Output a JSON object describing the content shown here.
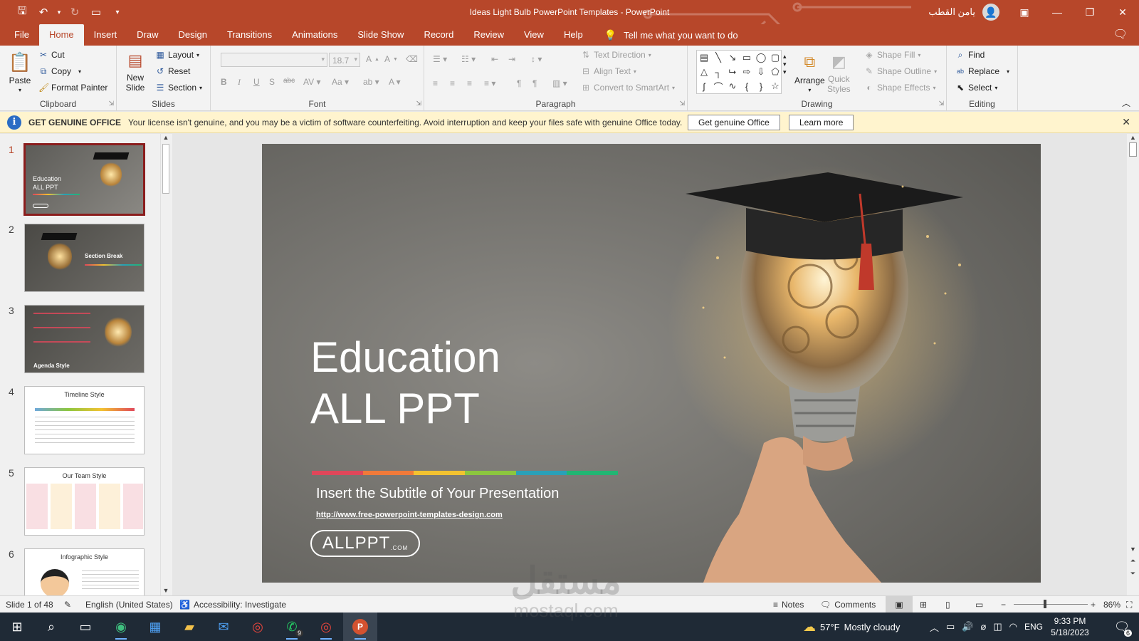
{
  "window": {
    "title": "Ideas Light Bulb PowerPoint Templates  -  PowerPoint",
    "user_name": "يامن القطب"
  },
  "tabs": [
    "File",
    "Home",
    "Insert",
    "Draw",
    "Design",
    "Transitions",
    "Animations",
    "Slide Show",
    "Record",
    "Review",
    "View",
    "Help"
  ],
  "active_tab": "Home",
  "tell_me": "Tell me what you want to do",
  "ribbon": {
    "clipboard": {
      "label": "Clipboard",
      "paste": "Paste",
      "cut": "Cut",
      "copy": "Copy",
      "format_painter": "Format Painter"
    },
    "slides": {
      "label": "Slides",
      "new_slide_1": "New",
      "new_slide_2": "Slide",
      "layout": "Layout",
      "reset": "Reset",
      "section": "Section"
    },
    "font": {
      "label": "Font",
      "font_size": "18.7"
    },
    "paragraph": {
      "label": "Paragraph",
      "text_direction": "Text Direction",
      "align_text": "Align Text",
      "convert_smartart": "Convert to SmartArt"
    },
    "drawing": {
      "label": "Drawing",
      "arrange": "Arrange",
      "quick_styles_1": "Quick",
      "quick_styles_2": "Styles",
      "shape_fill": "Shape Fill",
      "shape_outline": "Shape Outline",
      "shape_effects": "Shape Effects"
    },
    "editing": {
      "label": "Editing",
      "find": "Find",
      "replace": "Replace",
      "select": "Select"
    }
  },
  "license_bar": {
    "title": "GET GENUINE OFFICE",
    "message": "Your license isn't genuine, and you may be a victim of software counterfeiting. Avoid interruption and keep your files safe with genuine Office today.",
    "btn_genuine": "Get genuine Office",
    "btn_learn": "Learn more"
  },
  "thumbnails": [
    {
      "num": "1",
      "line1": "Education",
      "line2": "ALL PPT"
    },
    {
      "num": "2",
      "caption": "Section Break"
    },
    {
      "num": "3",
      "caption": "Agenda Style"
    },
    {
      "num": "4",
      "caption": "Timeline Style"
    },
    {
      "num": "5",
      "caption": "Our Team Style"
    },
    {
      "num": "6",
      "caption": "Infographic Style"
    }
  ],
  "slide": {
    "title_line1": "Education",
    "title_line2": "ALL PPT",
    "subtitle": "Insert the Subtitle of Your Presentation",
    "url": "http://www.free-powerpoint-templates-design.com",
    "logo_main": "ALLPPT",
    "logo_suffix": ".COM",
    "stripe_colors": [
      "#e0475a",
      "#f07a3a",
      "#f2c230",
      "#8cc63f",
      "#2aa0b8",
      "#22b573"
    ]
  },
  "status": {
    "slide_info": "Slide 1 of 48",
    "language": "English (United States)",
    "accessibility": "Accessibility: Investigate",
    "notes": "Notes",
    "comments": "Comments",
    "zoom": "86%"
  },
  "taskbar": {
    "weather_temp": "57°F",
    "weather_desc": "Mostly cloudy",
    "lang": "ENG",
    "time": "9:33 PM",
    "date": "5/18/2023",
    "notif_count": "6",
    "whatsapp_badge": "9"
  },
  "watermark": {
    "line1": "مستقل",
    "line2": "mostaql.com"
  }
}
